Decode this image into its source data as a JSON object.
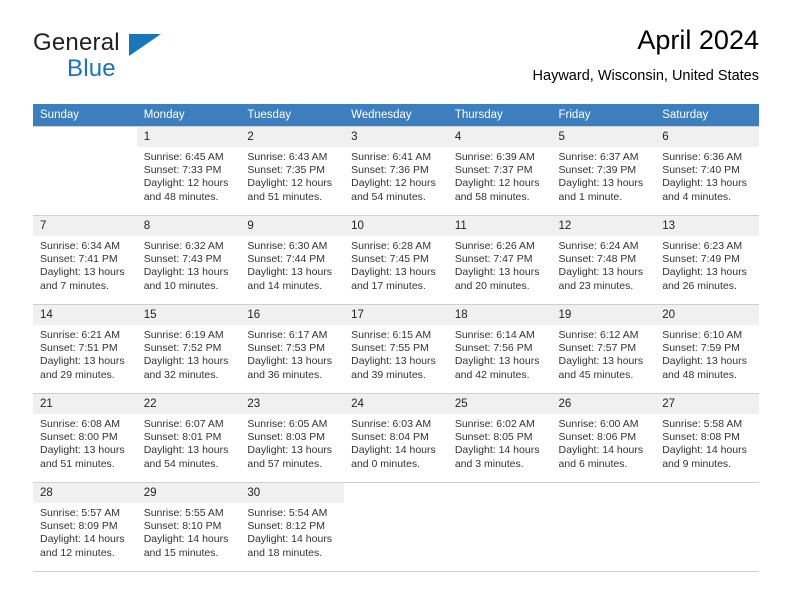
{
  "brand": {
    "line1": "General",
    "line2": "Blue",
    "accent_color": "#1b75bb"
  },
  "header": {
    "title": "April 2024",
    "location": "Hayward, Wisconsin, United States"
  },
  "calendar": {
    "header_color": "#3d7ebf",
    "weekdays": [
      "Sunday",
      "Monday",
      "Tuesday",
      "Wednesday",
      "Thursday",
      "Friday",
      "Saturday"
    ],
    "labels": {
      "sunrise": "Sunrise:",
      "sunset": "Sunset:",
      "daylight": "Daylight:"
    },
    "weeks": [
      [
        {
          "day": "",
          "sunrise": "",
          "sunset": "",
          "daylight_1": "",
          "daylight_2": ""
        },
        {
          "day": "1",
          "sunrise": "Sunrise: 6:45 AM",
          "sunset": "Sunset: 7:33 PM",
          "daylight_1": "Daylight: 12 hours",
          "daylight_2": "and 48 minutes."
        },
        {
          "day": "2",
          "sunrise": "Sunrise: 6:43 AM",
          "sunset": "Sunset: 7:35 PM",
          "daylight_1": "Daylight: 12 hours",
          "daylight_2": "and 51 minutes."
        },
        {
          "day": "3",
          "sunrise": "Sunrise: 6:41 AM",
          "sunset": "Sunset: 7:36 PM",
          "daylight_1": "Daylight: 12 hours",
          "daylight_2": "and 54 minutes."
        },
        {
          "day": "4",
          "sunrise": "Sunrise: 6:39 AM",
          "sunset": "Sunset: 7:37 PM",
          "daylight_1": "Daylight: 12 hours",
          "daylight_2": "and 58 minutes."
        },
        {
          "day": "5",
          "sunrise": "Sunrise: 6:37 AM",
          "sunset": "Sunset: 7:39 PM",
          "daylight_1": "Daylight: 13 hours",
          "daylight_2": "and 1 minute."
        },
        {
          "day": "6",
          "sunrise": "Sunrise: 6:36 AM",
          "sunset": "Sunset: 7:40 PM",
          "daylight_1": "Daylight: 13 hours",
          "daylight_2": "and 4 minutes."
        }
      ],
      [
        {
          "day": "7",
          "sunrise": "Sunrise: 6:34 AM",
          "sunset": "Sunset: 7:41 PM",
          "daylight_1": "Daylight: 13 hours",
          "daylight_2": "and 7 minutes."
        },
        {
          "day": "8",
          "sunrise": "Sunrise: 6:32 AM",
          "sunset": "Sunset: 7:43 PM",
          "daylight_1": "Daylight: 13 hours",
          "daylight_2": "and 10 minutes."
        },
        {
          "day": "9",
          "sunrise": "Sunrise: 6:30 AM",
          "sunset": "Sunset: 7:44 PM",
          "daylight_1": "Daylight: 13 hours",
          "daylight_2": "and 14 minutes."
        },
        {
          "day": "10",
          "sunrise": "Sunrise: 6:28 AM",
          "sunset": "Sunset: 7:45 PM",
          "daylight_1": "Daylight: 13 hours",
          "daylight_2": "and 17 minutes."
        },
        {
          "day": "11",
          "sunrise": "Sunrise: 6:26 AM",
          "sunset": "Sunset: 7:47 PM",
          "daylight_1": "Daylight: 13 hours",
          "daylight_2": "and 20 minutes."
        },
        {
          "day": "12",
          "sunrise": "Sunrise: 6:24 AM",
          "sunset": "Sunset: 7:48 PM",
          "daylight_1": "Daylight: 13 hours",
          "daylight_2": "and 23 minutes."
        },
        {
          "day": "13",
          "sunrise": "Sunrise: 6:23 AM",
          "sunset": "Sunset: 7:49 PM",
          "daylight_1": "Daylight: 13 hours",
          "daylight_2": "and 26 minutes."
        }
      ],
      [
        {
          "day": "14",
          "sunrise": "Sunrise: 6:21 AM",
          "sunset": "Sunset: 7:51 PM",
          "daylight_1": "Daylight: 13 hours",
          "daylight_2": "and 29 minutes."
        },
        {
          "day": "15",
          "sunrise": "Sunrise: 6:19 AM",
          "sunset": "Sunset: 7:52 PM",
          "daylight_1": "Daylight: 13 hours",
          "daylight_2": "and 32 minutes."
        },
        {
          "day": "16",
          "sunrise": "Sunrise: 6:17 AM",
          "sunset": "Sunset: 7:53 PM",
          "daylight_1": "Daylight: 13 hours",
          "daylight_2": "and 36 minutes."
        },
        {
          "day": "17",
          "sunrise": "Sunrise: 6:15 AM",
          "sunset": "Sunset: 7:55 PM",
          "daylight_1": "Daylight: 13 hours",
          "daylight_2": "and 39 minutes."
        },
        {
          "day": "18",
          "sunrise": "Sunrise: 6:14 AM",
          "sunset": "Sunset: 7:56 PM",
          "daylight_1": "Daylight: 13 hours",
          "daylight_2": "and 42 minutes."
        },
        {
          "day": "19",
          "sunrise": "Sunrise: 6:12 AM",
          "sunset": "Sunset: 7:57 PM",
          "daylight_1": "Daylight: 13 hours",
          "daylight_2": "and 45 minutes."
        },
        {
          "day": "20",
          "sunrise": "Sunrise: 6:10 AM",
          "sunset": "Sunset: 7:59 PM",
          "daylight_1": "Daylight: 13 hours",
          "daylight_2": "and 48 minutes."
        }
      ],
      [
        {
          "day": "21",
          "sunrise": "Sunrise: 6:08 AM",
          "sunset": "Sunset: 8:00 PM",
          "daylight_1": "Daylight: 13 hours",
          "daylight_2": "and 51 minutes."
        },
        {
          "day": "22",
          "sunrise": "Sunrise: 6:07 AM",
          "sunset": "Sunset: 8:01 PM",
          "daylight_1": "Daylight: 13 hours",
          "daylight_2": "and 54 minutes."
        },
        {
          "day": "23",
          "sunrise": "Sunrise: 6:05 AM",
          "sunset": "Sunset: 8:03 PM",
          "daylight_1": "Daylight: 13 hours",
          "daylight_2": "and 57 minutes."
        },
        {
          "day": "24",
          "sunrise": "Sunrise: 6:03 AM",
          "sunset": "Sunset: 8:04 PM",
          "daylight_1": "Daylight: 14 hours",
          "daylight_2": "and 0 minutes."
        },
        {
          "day": "25",
          "sunrise": "Sunrise: 6:02 AM",
          "sunset": "Sunset: 8:05 PM",
          "daylight_1": "Daylight: 14 hours",
          "daylight_2": "and 3 minutes."
        },
        {
          "day": "26",
          "sunrise": "Sunrise: 6:00 AM",
          "sunset": "Sunset: 8:06 PM",
          "daylight_1": "Daylight: 14 hours",
          "daylight_2": "and 6 minutes."
        },
        {
          "day": "27",
          "sunrise": "Sunrise: 5:58 AM",
          "sunset": "Sunset: 8:08 PM",
          "daylight_1": "Daylight: 14 hours",
          "daylight_2": "and 9 minutes."
        }
      ],
      [
        {
          "day": "28",
          "sunrise": "Sunrise: 5:57 AM",
          "sunset": "Sunset: 8:09 PM",
          "daylight_1": "Daylight: 14 hours",
          "daylight_2": "and 12 minutes."
        },
        {
          "day": "29",
          "sunrise": "Sunrise: 5:55 AM",
          "sunset": "Sunset: 8:10 PM",
          "daylight_1": "Daylight: 14 hours",
          "daylight_2": "and 15 minutes."
        },
        {
          "day": "30",
          "sunrise": "Sunrise: 5:54 AM",
          "sunset": "Sunset: 8:12 PM",
          "daylight_1": "Daylight: 14 hours",
          "daylight_2": "and 18 minutes."
        },
        {
          "day": "",
          "sunrise": "",
          "sunset": "",
          "daylight_1": "",
          "daylight_2": ""
        },
        {
          "day": "",
          "sunrise": "",
          "sunset": "",
          "daylight_1": "",
          "daylight_2": ""
        },
        {
          "day": "",
          "sunrise": "",
          "sunset": "",
          "daylight_1": "",
          "daylight_2": ""
        },
        {
          "day": "",
          "sunrise": "",
          "sunset": "",
          "daylight_1": "",
          "daylight_2": ""
        }
      ]
    ]
  }
}
